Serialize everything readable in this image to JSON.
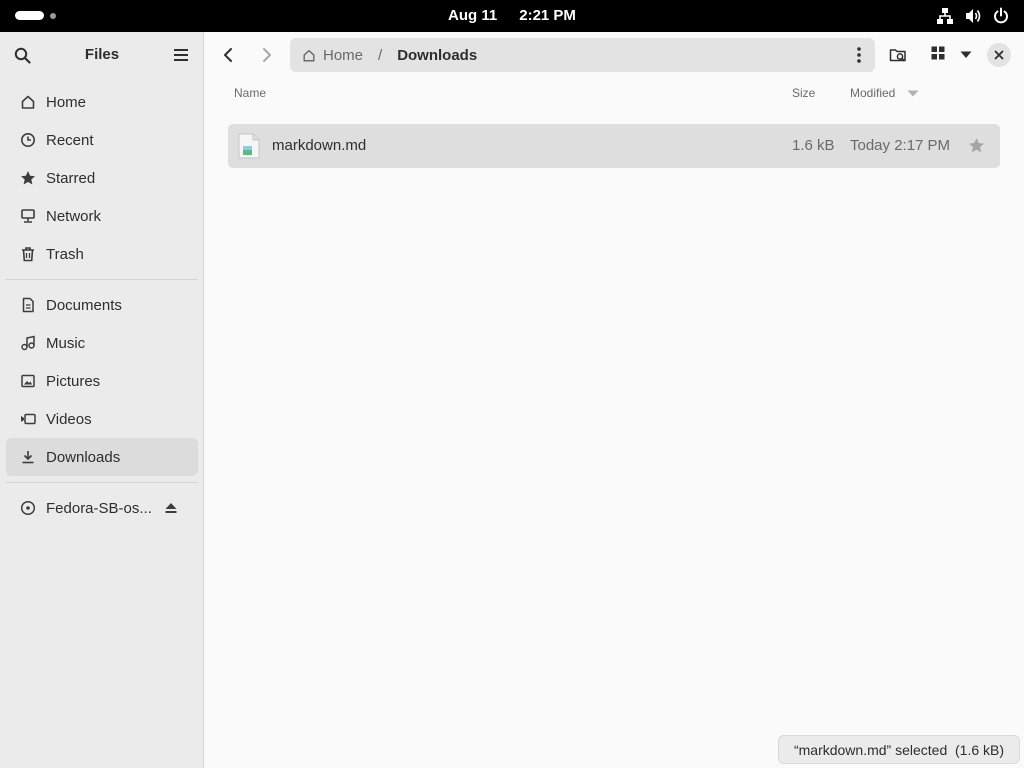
{
  "topbar": {
    "date": "Aug 11",
    "time": "2:21 PM",
    "tray_icons": [
      "network-icon",
      "volume-icon",
      "power-icon"
    ]
  },
  "sidebar": {
    "title": "Files",
    "places": [
      {
        "label": "Home",
        "icon": "home-icon"
      },
      {
        "label": "Recent",
        "icon": "clock-icon"
      },
      {
        "label": "Starred",
        "icon": "star-icon"
      },
      {
        "label": "Network",
        "icon": "network-icon"
      },
      {
        "label": "Trash",
        "icon": "trash-icon"
      }
    ],
    "bookmarks": [
      {
        "label": "Documents",
        "icon": "document-icon"
      },
      {
        "label": "Music",
        "icon": "music-icon"
      },
      {
        "label": "Pictures",
        "icon": "picture-icon"
      },
      {
        "label": "Videos",
        "icon": "video-icon"
      },
      {
        "label": "Downloads",
        "icon": "download-icon",
        "active": true
      }
    ],
    "devices": [
      {
        "label": "Fedora-SB-os...",
        "icon": "disc-icon",
        "ejectable": true
      }
    ]
  },
  "pathbar": {
    "home": "Home",
    "separator": "/",
    "current": "Downloads"
  },
  "columns": {
    "name": "Name",
    "size": "Size",
    "modified": "Modified"
  },
  "files": [
    {
      "name": "markdown.md",
      "size": "1.6 kB",
      "modified": "Today 2:17 PM",
      "selected": true
    }
  ],
  "status": "“markdown.md” selected  (1.6 kB)",
  "colors": {
    "topbar": "#000000",
    "sidebar": "#ebebeb",
    "content": "#fafafa",
    "selection": "#dedede"
  }
}
